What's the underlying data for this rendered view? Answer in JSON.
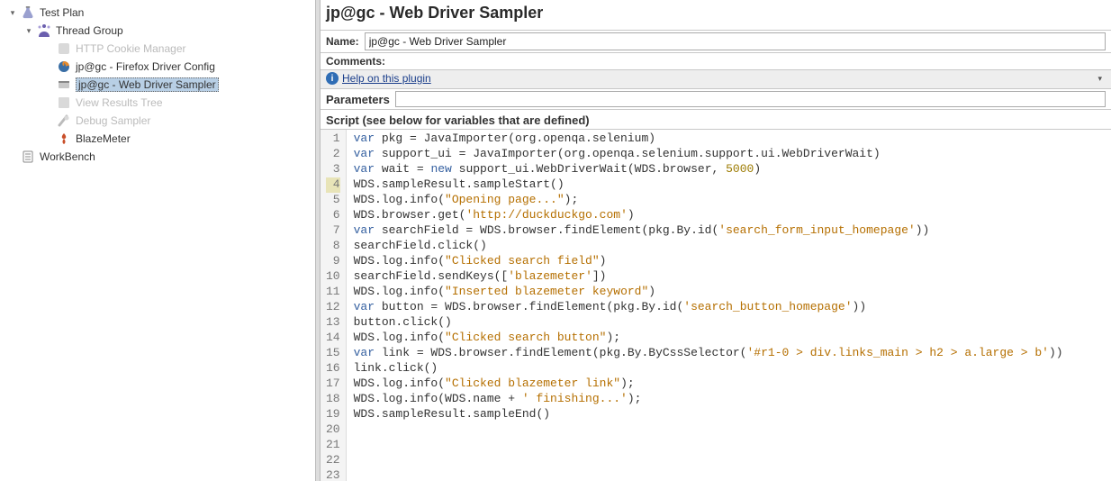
{
  "tree": {
    "test_plan": "Test Plan",
    "thread_group": "Thread Group",
    "cookie_manager": "HTTP Cookie Manager",
    "firefox_driver": "jp@gc - Firefox Driver Config",
    "webdriver_sampler": "jp@gc - Web Driver Sampler",
    "view_results": "View Results Tree",
    "debug_sampler": "Debug Sampler",
    "blazemeter": "BlazeMeter",
    "workbench": "WorkBench"
  },
  "panel": {
    "title": "jp@gc - Web Driver Sampler",
    "name_label": "Name:",
    "name_value": "jp@gc - Web Driver Sampler",
    "comments_label": "Comments:",
    "help_link": "Help on this plugin",
    "parameters_label": "Parameters",
    "script_label": "Script (see below for variables that are defined)"
  },
  "code": {
    "active_line": 4,
    "lines": [
      [
        [
          "kw",
          "var"
        ],
        [
          "",
          " pkg = JavaImporter(org.openqa.selenium)"
        ]
      ],
      [
        [
          "kw",
          "var"
        ],
        [
          "",
          " support_ui = JavaImporter(org.openqa.selenium.support.ui.WebDriverWait)"
        ]
      ],
      [
        [
          "kw",
          "var"
        ],
        [
          "",
          " wait = "
        ],
        [
          "kw",
          "new"
        ],
        [
          "",
          " support_ui.WebDriverWait(WDS.browser, "
        ],
        [
          "num",
          "5000"
        ],
        [
          "",
          ")"
        ]
      ],
      [
        [
          "",
          "WDS.sampleResult.sampleStart()"
        ]
      ],
      [
        [
          "",
          "WDS.log.info("
        ],
        [
          "str",
          "\"Opening page...\""
        ],
        [
          "",
          ");"
        ]
      ],
      [
        [
          "",
          "WDS.browser.get("
        ],
        [
          "str",
          "'http://duckduckgo.com'"
        ],
        [
          "",
          ")"
        ]
      ],
      [
        [
          "kw",
          "var"
        ],
        [
          "",
          " searchField = WDS.browser.findElement(pkg.By.id("
        ],
        [
          "str",
          "'search_form_input_homepage'"
        ],
        [
          "",
          "))"
        ]
      ],
      [
        [
          "",
          "searchField.click()"
        ]
      ],
      [
        [
          "",
          "WDS.log.info("
        ],
        [
          "str",
          "\"Clicked search field\""
        ],
        [
          "",
          ")"
        ]
      ],
      [
        [
          "",
          "searchField.sendKeys(["
        ],
        [
          "str",
          "'blazemeter'"
        ],
        [
          "",
          "])"
        ]
      ],
      [
        [
          "",
          "WDS.log.info("
        ],
        [
          "str",
          "\"Inserted blazemeter keyword\""
        ],
        [
          "",
          ")"
        ]
      ],
      [
        [
          "kw",
          "var"
        ],
        [
          "",
          " button = WDS.browser.findElement(pkg.By.id("
        ],
        [
          "str",
          "'search_button_homepage'"
        ],
        [
          "",
          "))"
        ]
      ],
      [
        [
          "",
          "button.click()"
        ]
      ],
      [
        [
          "",
          "WDS.log.info("
        ],
        [
          "str",
          "\"Clicked search button\""
        ],
        [
          "",
          ");"
        ]
      ],
      [
        [
          "kw",
          "var"
        ],
        [
          "",
          " link = WDS.browser.findElement(pkg.By.ByCssSelector("
        ],
        [
          "str",
          "'#r1-0 > div.links_main > h2 > a.large > b'"
        ],
        [
          "",
          "))"
        ]
      ],
      [
        [
          "",
          "link.click()"
        ]
      ],
      [
        [
          "",
          "WDS.log.info("
        ],
        [
          "str",
          "\"Clicked blazemeter link\""
        ],
        [
          "",
          ");"
        ]
      ],
      [
        [
          "",
          "WDS.log.info(WDS.name + "
        ],
        [
          "str",
          "' finishing...'"
        ],
        [
          "",
          ");"
        ]
      ],
      [
        [
          "",
          "WDS.sampleResult.sampleEnd()"
        ]
      ],
      [
        [
          "",
          ""
        ]
      ],
      [
        [
          "",
          ""
        ]
      ],
      [
        [
          "",
          ""
        ]
      ],
      [
        [
          "",
          ""
        ]
      ]
    ]
  }
}
